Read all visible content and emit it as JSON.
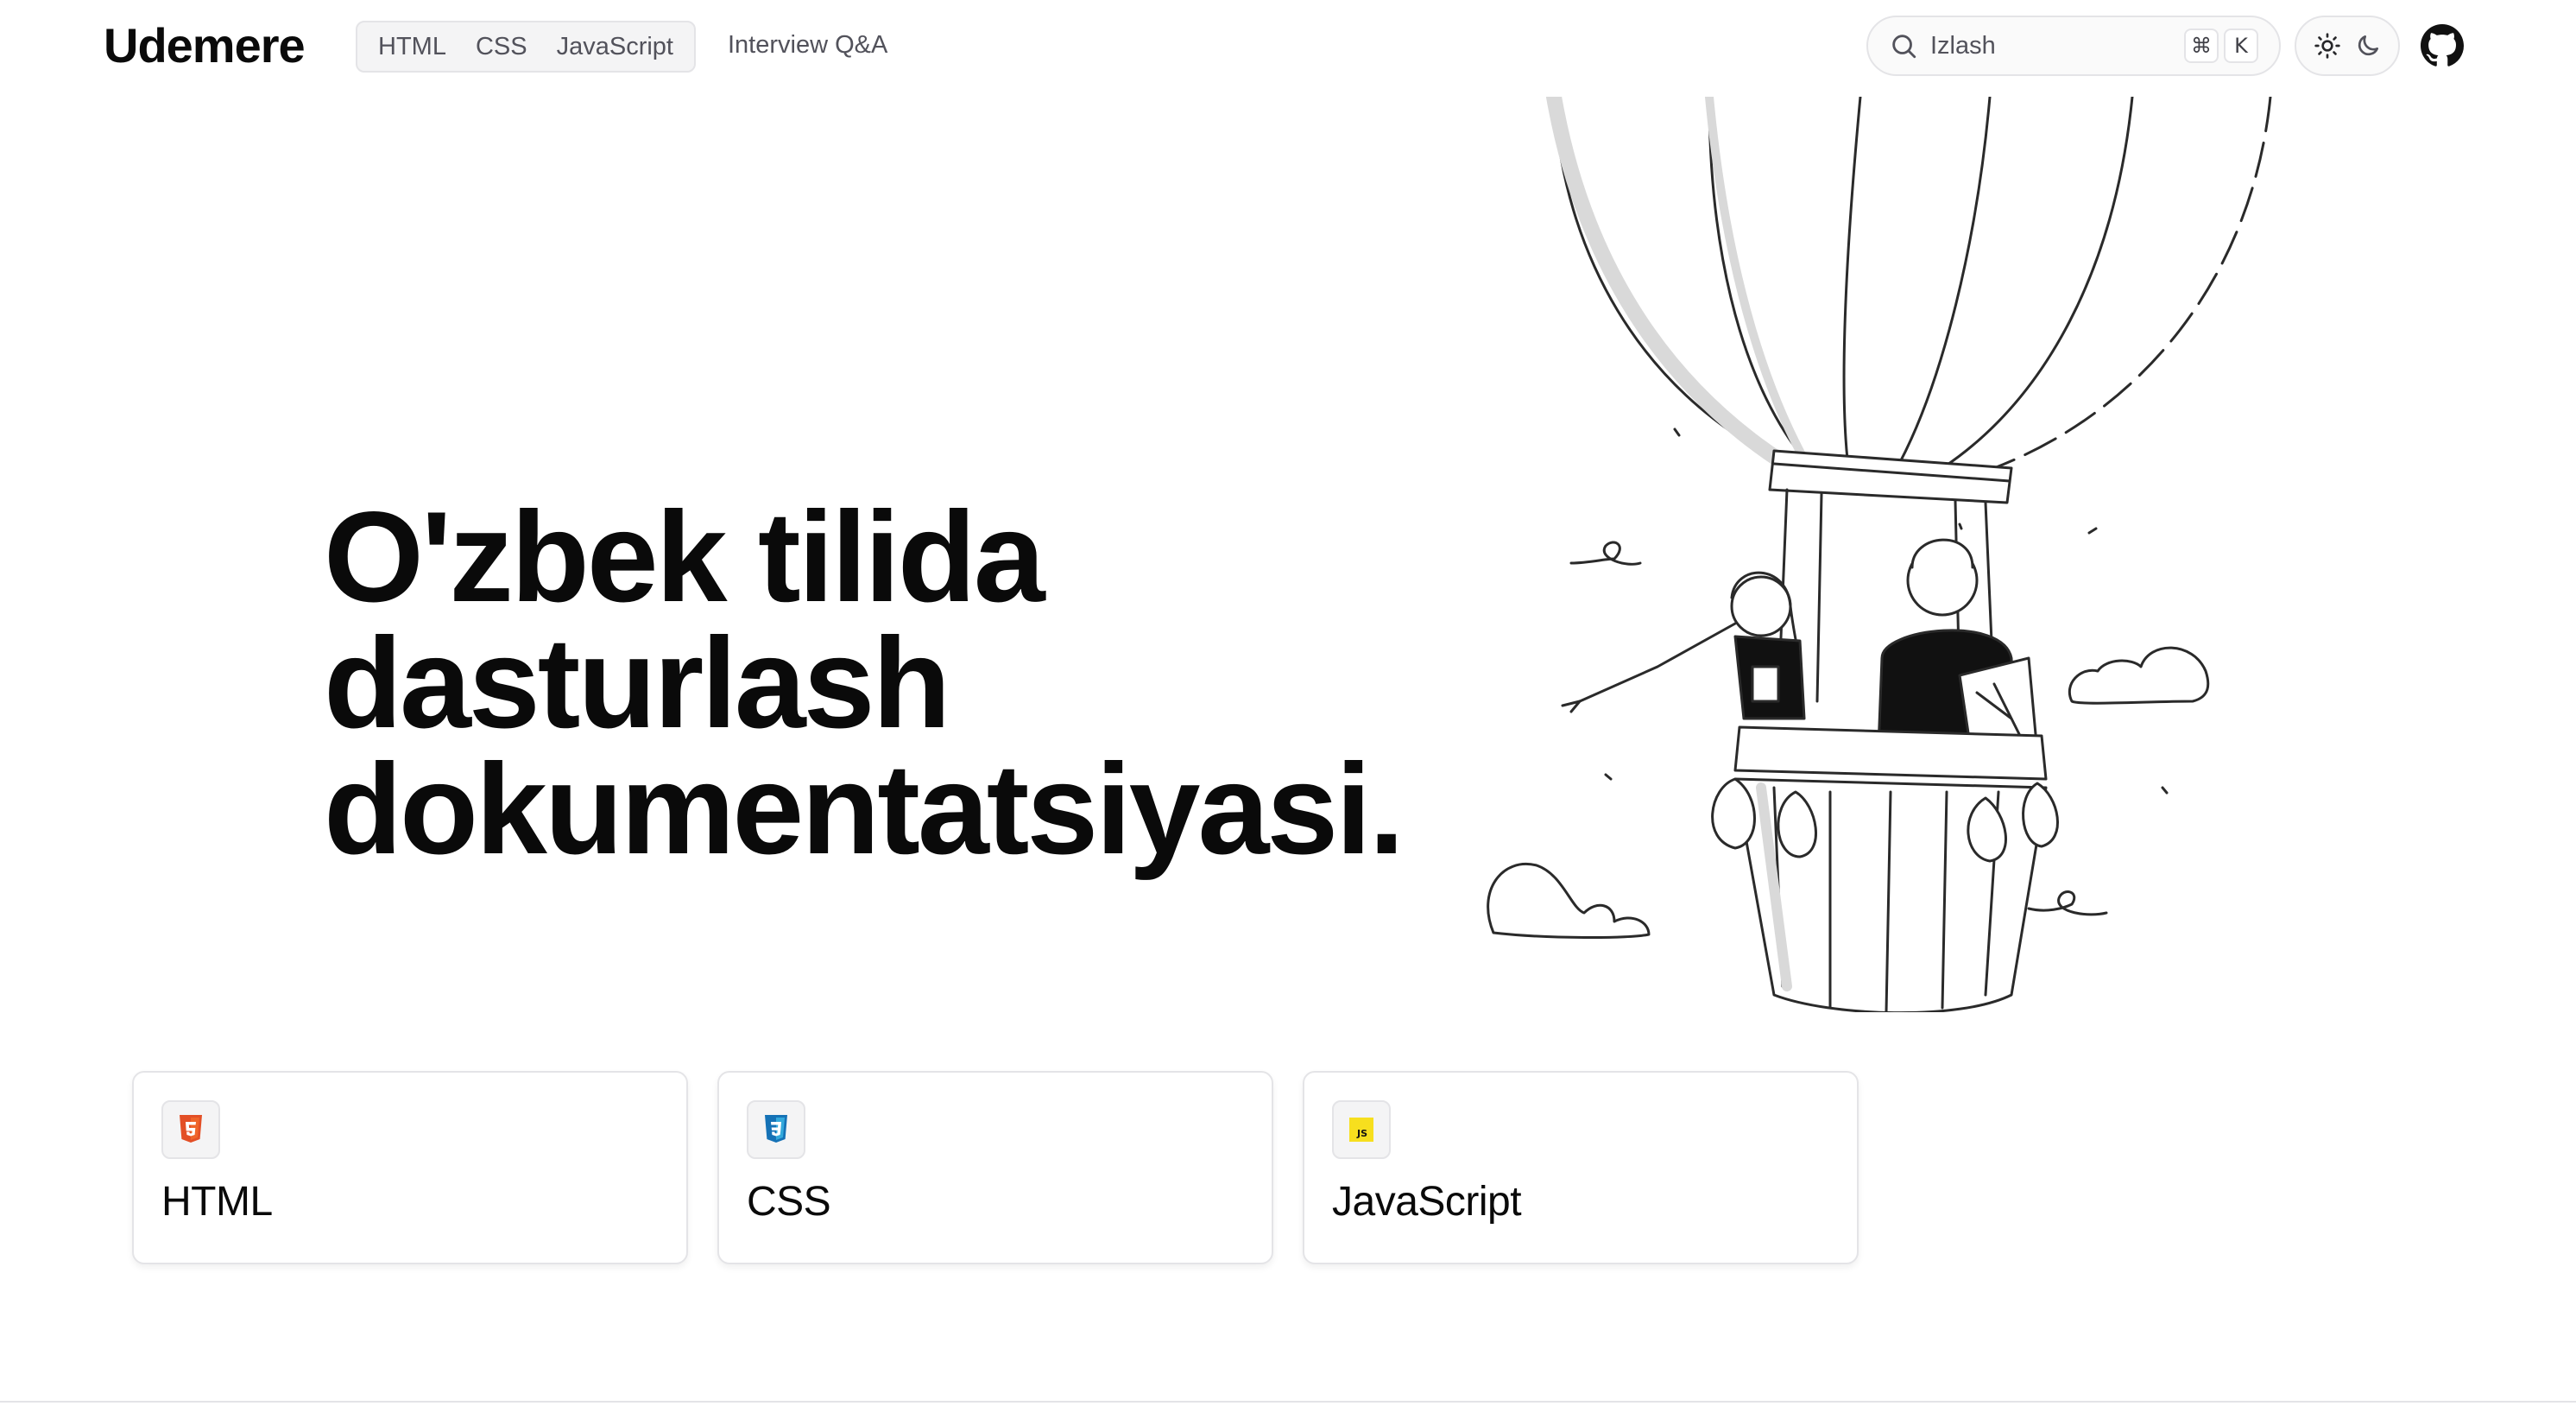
{
  "header": {
    "logo": "Udemere",
    "nav": [
      {
        "label": "HTML"
      },
      {
        "label": "CSS"
      },
      {
        "label": "JavaScript"
      }
    ],
    "extra_link": "Interview Q&A",
    "search": {
      "placeholder": "Izlash",
      "shortcut_mod": "⌘",
      "shortcut_key": "K"
    },
    "theme": {
      "light_icon": "sun-icon",
      "dark_icon": "moon-icon"
    },
    "github_icon": "github-icon"
  },
  "hero": {
    "title_lines": [
      "O'zbek tilida",
      "dasturlash",
      "dokumentatsiyasi."
    ],
    "illustration": "hot-air-balloon-illustration"
  },
  "cards": [
    {
      "title": "HTML",
      "icon": "html5-icon",
      "color": "#e34f26"
    },
    {
      "title": "CSS",
      "icon": "css3-icon",
      "color": "#1572b6"
    },
    {
      "title": "JavaScript",
      "icon": "js-icon",
      "color": "#f7df1e"
    }
  ]
}
